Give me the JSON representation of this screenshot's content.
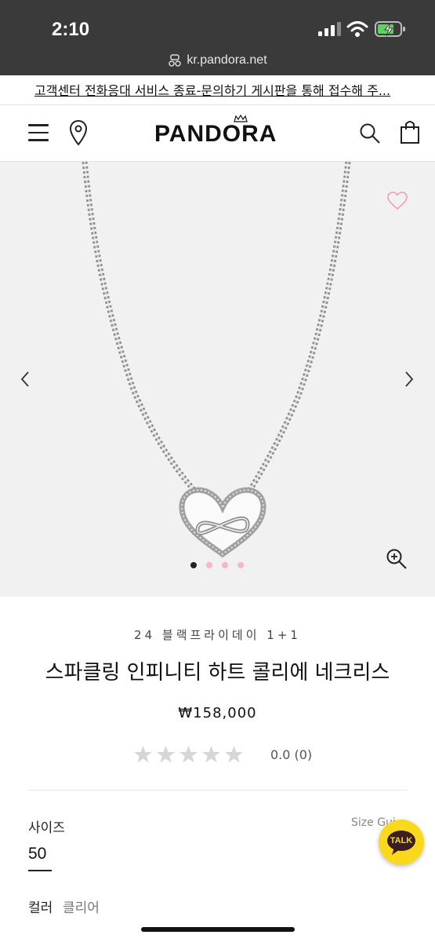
{
  "status_bar": {
    "time": "2:10",
    "url": "kr.pandora.net"
  },
  "announcement": {
    "text": "고객센터 전화응대 서비스 종료-문의하기 게시판을 통해 접수해 주..."
  },
  "header": {
    "logo": "PANDORA",
    "menu_icon": "hamburger-menu-icon",
    "store_icon": "location-pin-icon",
    "search_icon": "search-icon",
    "bag_icon": "shopping-bag-icon"
  },
  "gallery": {
    "image_count": 4,
    "active_index": 0,
    "colors": {
      "active_dot": "#222222",
      "inactive_dot": "#f4b6c8",
      "heart": "#f19bb5",
      "background": "#f1f1f1"
    }
  },
  "product": {
    "promo": "24 블랙프라이데이 1+1",
    "title": "스파클링 인피니티 하트 콜리에 네크리스",
    "price": "₩158,000",
    "rating_value": 0,
    "rating_text": "0.0 (0)",
    "size_label": "사이즈",
    "size_guide": "Size Gui",
    "size_value": "50",
    "color_label": "컬러",
    "color_value": "클리어"
  },
  "chat": {
    "label": "TALK",
    "color": "#f9d91d"
  }
}
